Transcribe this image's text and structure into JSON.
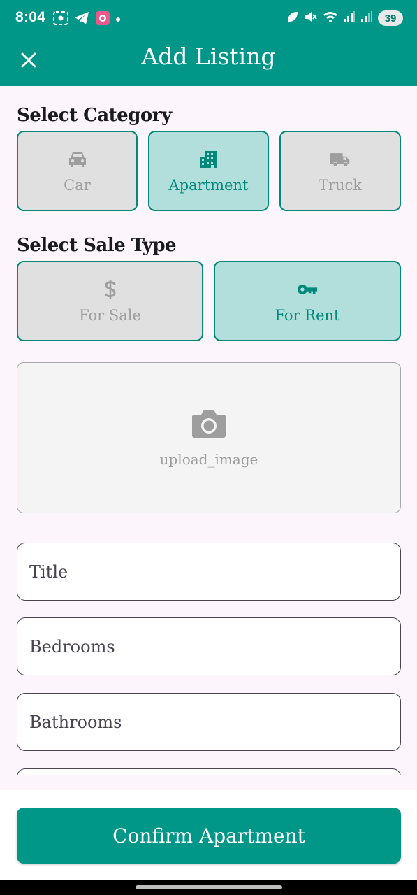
{
  "status_bar": {
    "time": "8:04",
    "battery": "39",
    "left_icons": [
      "screenshot-icon",
      "telegram-icon",
      "app-notification-icon",
      "more-dot"
    ],
    "right_icons": [
      "leaf-icon",
      "mute-icon",
      "wifi-icon",
      "signal-icon",
      "signal-icon-2",
      "battery-icon"
    ]
  },
  "app_bar": {
    "title": "Add Listing",
    "close_icon": "close-icon"
  },
  "category": {
    "title": "Select Category",
    "options": [
      {
        "label": "Car",
        "icon": "car-icon",
        "selected": false
      },
      {
        "label": "Apartment",
        "icon": "apartment-icon",
        "selected": true
      },
      {
        "label": "Truck",
        "icon": "truck-icon",
        "selected": false
      }
    ]
  },
  "sale_type": {
    "title": "Select Sale Type",
    "options": [
      {
        "label": "For Sale",
        "icon": "dollar-icon",
        "selected": false
      },
      {
        "label": "For Rent",
        "icon": "key-icon",
        "selected": true
      }
    ]
  },
  "upload": {
    "label": "upload_image",
    "icon": "camera-icon"
  },
  "fields": {
    "title_placeholder": "Title",
    "bedrooms_placeholder": "Bedrooms",
    "bathrooms_placeholder": "Bathrooms"
  },
  "confirm_button": {
    "label": "Confirm Apartment"
  },
  "colors": {
    "primary": "#009688",
    "selected_bg": "#b2dfdb",
    "unselected_bg": "#e0e0e0",
    "page_bg": "#fcf5fc"
  }
}
